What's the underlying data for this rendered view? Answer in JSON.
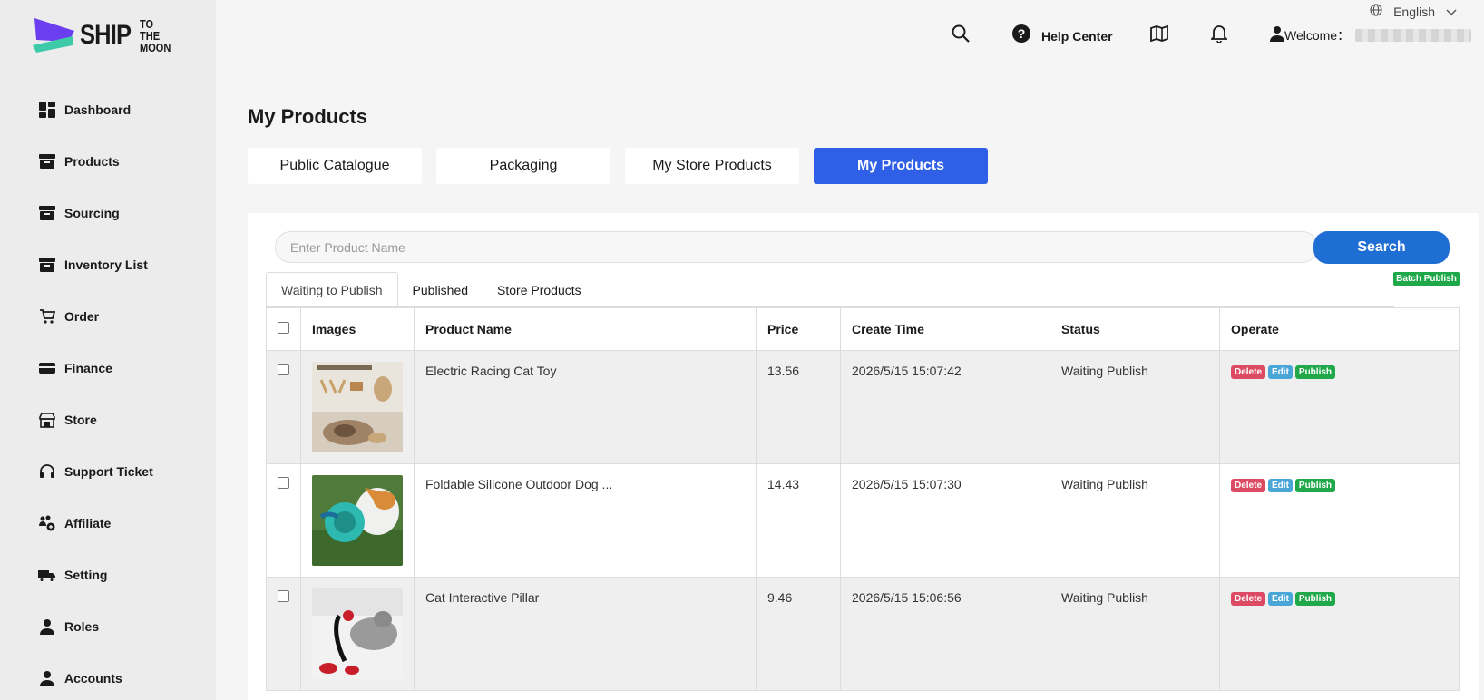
{
  "brand": {
    "name_big": "SHIP",
    "name_small_1": "TO THE",
    "name_small_2": "MOON"
  },
  "sidebar": {
    "items": [
      {
        "label": "Dashboard",
        "icon": "dashboard-icon"
      },
      {
        "label": "Products",
        "icon": "archive-box-icon"
      },
      {
        "label": "Sourcing",
        "icon": "archive-box-icon"
      },
      {
        "label": "Inventory List",
        "icon": "archive-box-icon"
      },
      {
        "label": "Order",
        "icon": "cart-icon"
      },
      {
        "label": "Finance",
        "icon": "credit-card-icon"
      },
      {
        "label": "Store",
        "icon": "store-icon"
      },
      {
        "label": "Support Ticket",
        "icon": "headset-icon"
      },
      {
        "label": "Affiliate",
        "icon": "affiliate-icon"
      },
      {
        "label": "Setting",
        "icon": "truck-icon"
      },
      {
        "label": "Roles",
        "icon": "user-icon"
      },
      {
        "label": "Accounts",
        "icon": "user-icon"
      }
    ]
  },
  "topbar": {
    "language": "English",
    "help_label": "Help Center",
    "welcome_label": "Welcome："
  },
  "page": {
    "title": "My Products",
    "tabs": [
      "Public Catalogue",
      "Packaging",
      "My Store Products",
      "My Products"
    ],
    "active_tab": "My Products"
  },
  "search": {
    "placeholder": "Enter Product Name",
    "button_label": "Search"
  },
  "batch_publish_label": "Batch Publish",
  "sub_tabs": [
    "Waiting to Publish",
    "Published",
    "Store Products"
  ],
  "table": {
    "headers": {
      "images": "Images",
      "name": "Product Name",
      "price": "Price",
      "created": "Create Time",
      "status": "Status",
      "operate": "Operate"
    },
    "rows": [
      {
        "name": "Electric Racing Cat Toy",
        "price": "13.56",
        "created": "2026/5/15 15:07:42",
        "status": "Waiting Publish"
      },
      {
        "name": "Foldable Silicone Outdoor Dog ...",
        "price": "14.43",
        "created": "2026/5/15 15:07:30",
        "status": "Waiting Publish"
      },
      {
        "name": "Cat Interactive Pillar",
        "price": "9.46",
        "created": "2026/5/15 15:06:56",
        "status": "Waiting Publish"
      }
    ],
    "op_labels": {
      "delete": "Delete",
      "edit": "Edit",
      "publish": "Publish"
    }
  },
  "colors": {
    "primary": "#2f5fe6",
    "search_button": "#1f6ed4",
    "delete": "#dc4a63",
    "edit": "#4ba6d8",
    "publish": "#21a84a"
  }
}
